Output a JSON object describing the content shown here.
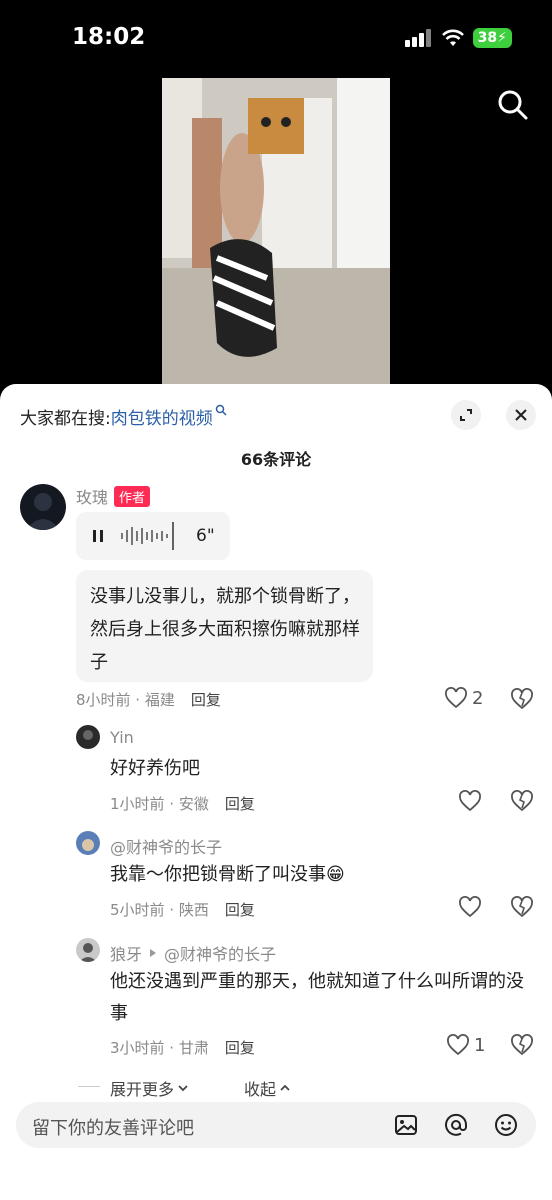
{
  "status": {
    "time": "18:02",
    "battery": "38"
  },
  "search": {
    "prefix": "大家都在搜:",
    "term": "肉包铁的视频"
  },
  "comments_header": {
    "count_label": "66条评论"
  },
  "main_comment": {
    "author": "玫瑰",
    "badge": "作者",
    "voice_duration": "6\"",
    "text": "没事儿没事儿，就那个锁骨断了，然后身上很多大面积擦伤嘛就那样子",
    "meta": "8小时前 · 福建",
    "reply_label": "回复",
    "likes": "2"
  },
  "replies": [
    {
      "author": "Yin",
      "reply_to": "",
      "text": "好好养伤吧",
      "meta": "1小时前 · 安徽",
      "reply_label": "回复",
      "likes": ""
    },
    {
      "author": "@财神爷的长子",
      "reply_to": "",
      "text": "我靠～你把锁骨断了叫没事😁",
      "meta": "5小时前 · 陕西",
      "reply_label": "回复",
      "likes": ""
    },
    {
      "author": "狼牙",
      "reply_to": "@财神爷的长子",
      "text": "他还没遇到严重的那天，他就知道了什么叫所谓的没事",
      "meta": "3小时前 · 甘肃",
      "reply_label": "回复",
      "likes": "1"
    }
  ],
  "footer_actions": {
    "expand": "展开更多",
    "collapse": "收起"
  },
  "input": {
    "placeholder": "留下你的友善评论吧"
  }
}
